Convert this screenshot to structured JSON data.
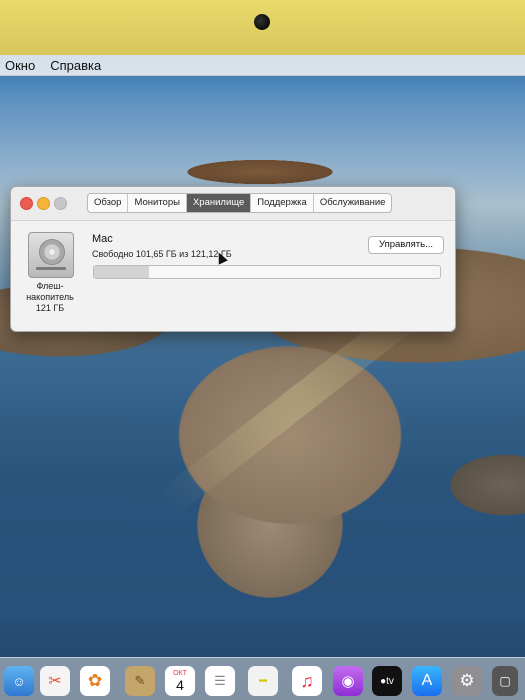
{
  "menubar": {
    "items": [
      "Окно",
      "Справка"
    ]
  },
  "window": {
    "tabs": [
      "Обзор",
      "Мониторы",
      "Хранилище",
      "Поддержка",
      "Обслуживание"
    ],
    "active_tab": "Хранилище",
    "disk": {
      "label_line1": "Флеш-",
      "label_line2": "накопитель",
      "label_line3": "121 ГБ",
      "icon": "hard-drive-icon"
    },
    "volume": {
      "name": "Mac",
      "free_text": "Свободно 101,65 ГБ из 121,12 ГБ",
      "used_fraction": 0.16
    },
    "manage_label": "Управлять..."
  },
  "dock": {
    "calendar": {
      "month": "ОКТ",
      "day": "4"
    },
    "icons": [
      "finder-icon",
      "photos-icon",
      "notes-icon",
      "calendar-icon",
      "reminders-icon",
      "music-icon",
      "podcasts-icon",
      "tv-icon",
      "app-store-icon",
      "settings-icon"
    ]
  }
}
